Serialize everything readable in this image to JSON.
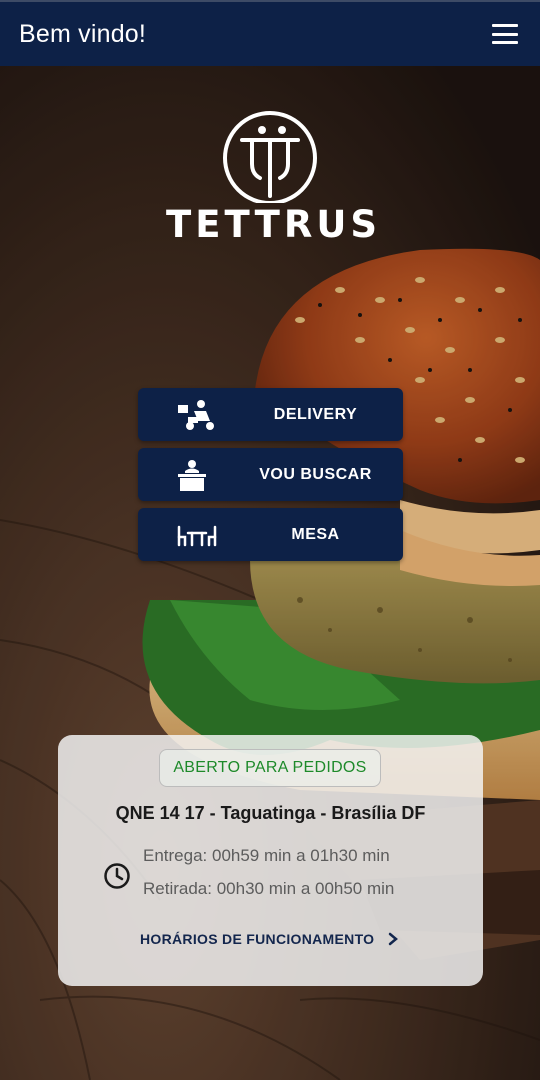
{
  "header": {
    "title": "Bem vindo!",
    "menu_icon": "hamburger-menu-icon"
  },
  "brand": {
    "name": "TETTRUS"
  },
  "order_options": [
    {
      "label": "DELIVERY",
      "icon": "delivery-icon"
    },
    {
      "label": "VOU BUSCAR",
      "icon": "pickup-counter-icon"
    },
    {
      "label": "MESA",
      "icon": "table-chairs-icon"
    }
  ],
  "store_info": {
    "status": "ABERTO PARA PEDIDOS",
    "address": "QNE 14 17 - Taguatinga - Brasília DF",
    "delivery_time": "Entrega: 00h59 min a 01h30 min",
    "pickup_time": "Retirada: 00h30 min a 00h50 min",
    "hours_link": "HORÁRIOS DE FUNCIONAMENTO"
  },
  "colors": {
    "primary": "#0d2147",
    "status_green": "#1e8a2a",
    "card_bg": "#f4f4f4"
  }
}
